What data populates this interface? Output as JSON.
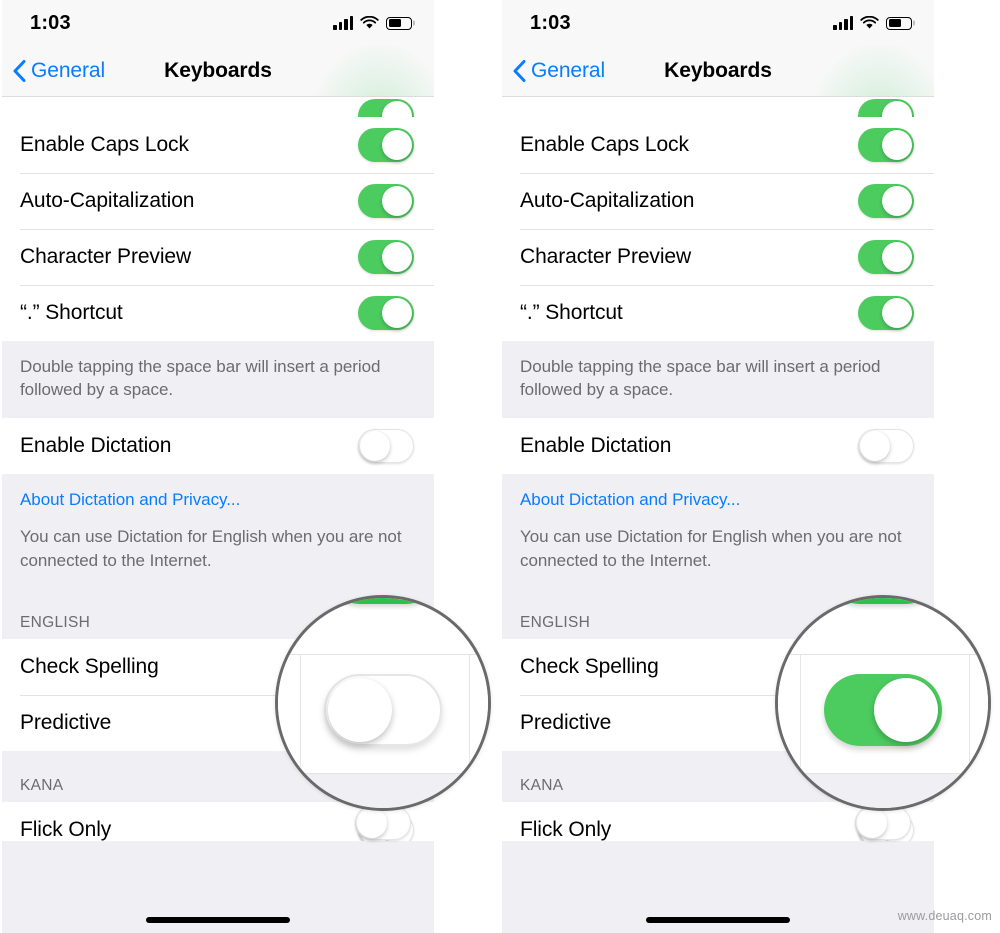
{
  "meta": {
    "watermark": "www.deuaq.com",
    "accent_blue": "#0a7cfe",
    "switch_green": "#4ccc5f",
    "group_bg": "#efeff4",
    "row_bg": "#ffffff",
    "separator": "#e3e3e6"
  },
  "status_bar": {
    "time": "1:03",
    "signal_icon": "cellular-signal-icon",
    "wifi_icon": "wifi-icon",
    "battery_icon": "battery-icon",
    "battery_level_percent": 62
  },
  "nav_bar": {
    "back_label": "General",
    "back_icon": "chevron-left-icon",
    "title": "Keyboards"
  },
  "panels": [
    {
      "id": "before",
      "caption_state": "Predictive toggle shown OFF in magnifier",
      "magnifier": {
        "switch_state": "off",
        "top_switch_state": "on"
      }
    },
    {
      "id": "after",
      "caption_state": "Predictive toggle shown ON in magnifier",
      "magnifier": {
        "switch_state": "on",
        "top_switch_state": "on"
      }
    }
  ],
  "list": {
    "partial_top_row": {
      "label": "",
      "switch": "on"
    },
    "group_keyboard": [
      {
        "label": "Enable Caps Lock",
        "switch": "on"
      },
      {
        "label": "Auto-Capitalization",
        "switch": "on"
      },
      {
        "label": "Character Preview",
        "switch": "on"
      },
      {
        "label": "“.” Shortcut",
        "switch": "on"
      }
    ],
    "note_shortcut": "Double tapping the space bar will insert a period followed by a space.",
    "group_dictation": [
      {
        "label": "Enable Dictation",
        "switch": "off"
      }
    ],
    "dictation_link": "About Dictation and Privacy...",
    "note_dictation": "You can use Dictation for English when you are not connected to the Internet.",
    "section_english": "ENGLISH",
    "group_english": [
      {
        "label": "Check Spelling",
        "switch": "on"
      },
      {
        "label": "Predictive",
        "switch": "off"
      }
    ],
    "section_kana": "KANA",
    "group_kana": [
      {
        "label": "Flick Only",
        "switch": "off"
      }
    ]
  },
  "home_indicator": "home-indicator-bar"
}
